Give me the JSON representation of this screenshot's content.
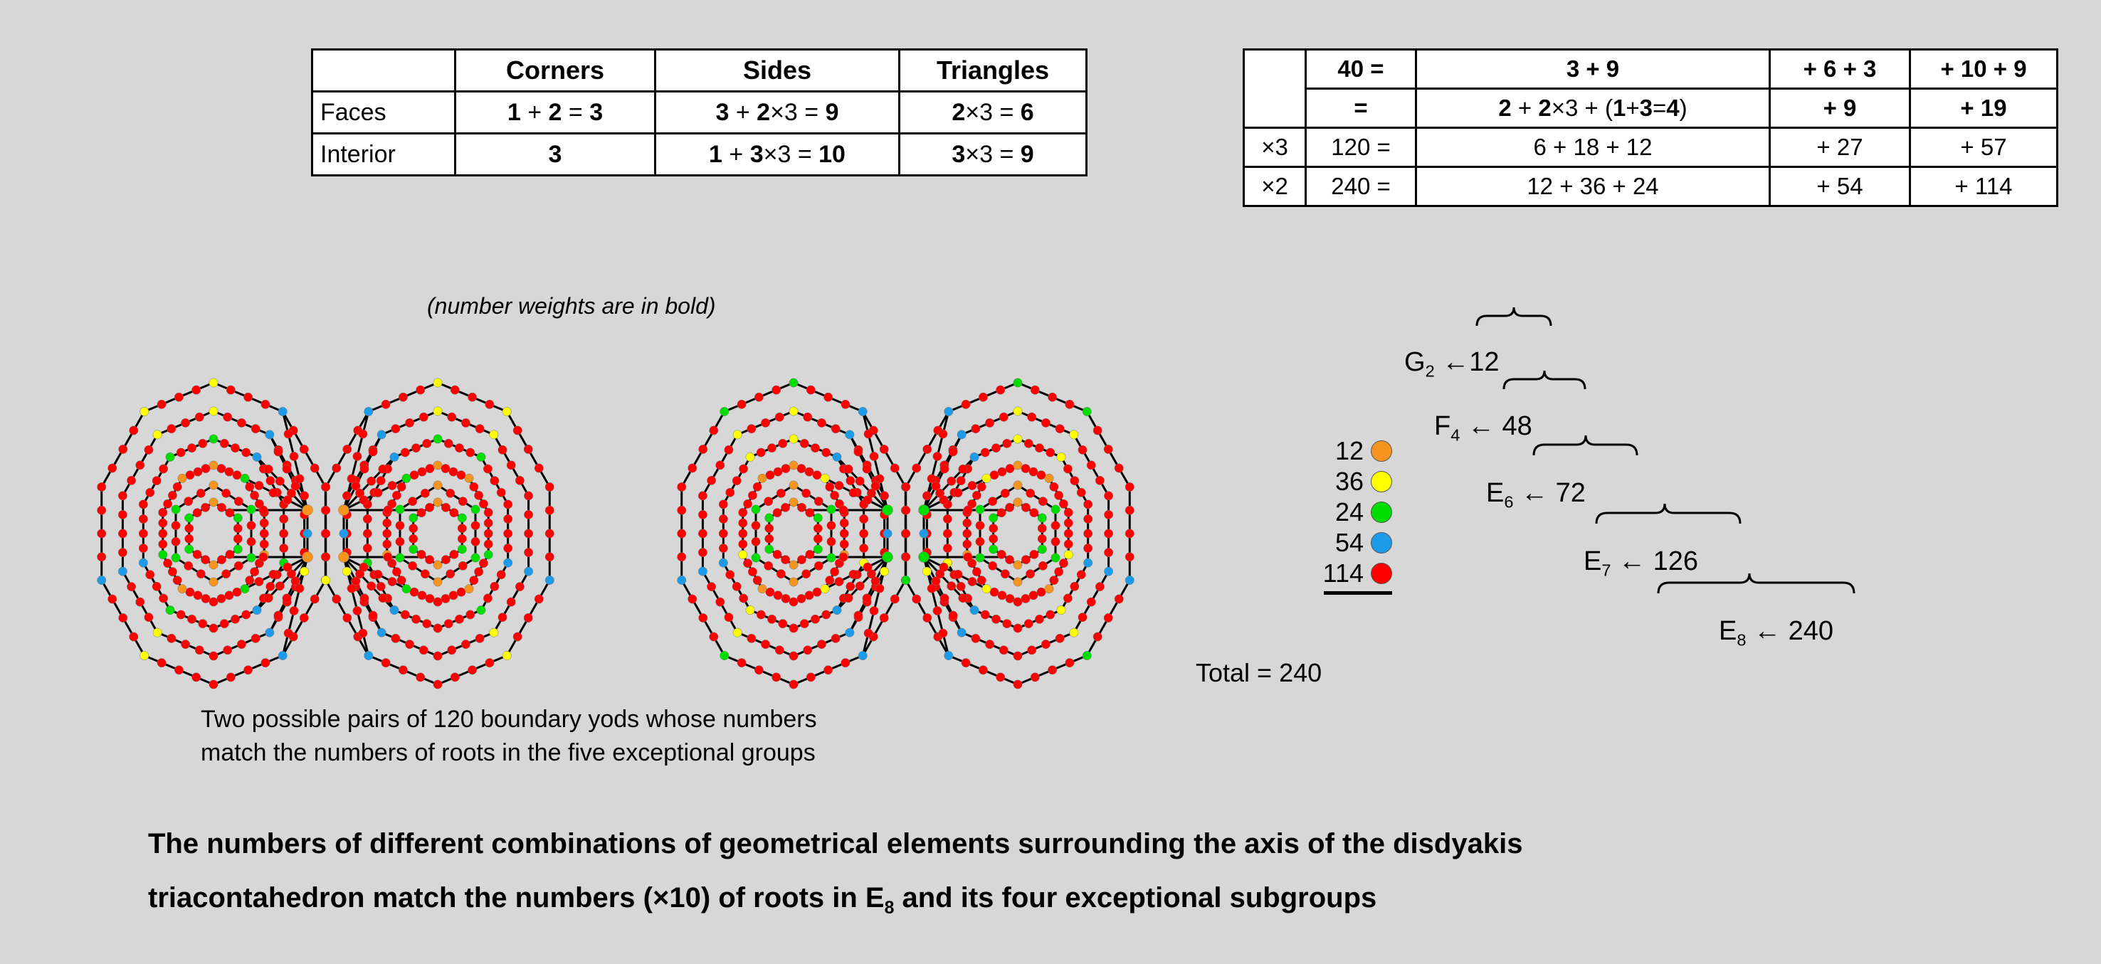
{
  "background": "#d7d7d7",
  "left_table": {
    "name": "geometrical-elements-table",
    "headers": [
      "",
      "Corners",
      "Sides",
      "Triangles"
    ],
    "rows": [
      {
        "label": "Faces",
        "corners_html": "<b>1</b> + <b>2</b> = <b>3</b>",
        "corners_text": "1 + 2 = 3",
        "sides_html": "<b>3</b> + <b>2</b>×3  = <b>9</b>",
        "sides_text": "3 + 2×3  = 9",
        "triangles_html": "<b>2</b>×3 = <b>6</b>",
        "triangles_text": "2×3 = 6"
      },
      {
        "label": "Interior",
        "corners_html": "<b>3</b>",
        "corners_text": "3",
        "sides_html": "<b>1</b> + <b>3</b>×3 = <b>10</b>",
        "sides_text": "1 + 3×3 = 10",
        "triangles_html": "<b>3</b>×3 = <b>9</b>",
        "triangles_text": "3×3 = 9"
      }
    ]
  },
  "note_weights": "(number weights are in bold)",
  "right_table": {
    "name": "root-decomposition-table",
    "rows": [
      {
        "multiplier": "",
        "total_html": "<b>40 =</b>",
        "total_text": "40 =",
        "col3_html": "<b>3 + 9</b>",
        "col3_text": "3 + 9",
        "col4_html": "<b>+ 6 + 3</b>",
        "col4_text": "+ 6 + 3",
        "col5_html": "<b>+ 10 + 9</b>",
        "col5_text": "+ 10 + 9"
      },
      {
        "multiplier": "",
        "total_html": "<b>=</b>",
        "total_text": "=",
        "col3_html": "<b>2</b> + <b>2</b>×3 + (<b>1</b>+<b>3</b>=<b>4</b>)",
        "col3_text": "2 + 2×3 + (1+3=4)",
        "col4_html": "<b>+ 9</b>",
        "col4_text": "+ 9",
        "col5_html": "<b>+ 19</b>",
        "col5_text": "+ 19"
      },
      {
        "multiplier": "×3",
        "total_html": "120 =",
        "total_text": "120 =",
        "col3_html": "6 + 18 + 12",
        "col3_text": "6 + 18 + 12",
        "col4_html": "+ 27",
        "col4_text": "+ 27",
        "col5_html": "+ 57",
        "col5_text": "+ 57"
      },
      {
        "multiplier": "×2",
        "total_html": "240 =",
        "total_text": "240 =",
        "col3_html": "12 + 36 + 24",
        "col3_text": "12 + 36 + 24",
        "col4_html": "+ 54",
        "col4_text": "+ 54",
        "col5_html": "+ 114",
        "col5_text": "+ 114"
      }
    ]
  },
  "legend": {
    "name": "yod-count-legend",
    "items": [
      {
        "count": "12",
        "color": "#f5941f"
      },
      {
        "count": "36",
        "color": "#ffff00"
      },
      {
        "count": "24",
        "color": "#00dd00"
      },
      {
        "count": "54",
        "color": "#1e9be8"
      },
      {
        "count": "114",
        "color": "#ff0000"
      }
    ],
    "total_label": "Total = 240",
    "total_value": "240"
  },
  "groups": [
    {
      "label": "G",
      "sub": "2",
      "arrow": "←",
      "value": "12"
    },
    {
      "label": "F",
      "sub": "4",
      "arrow": "←",
      "value": "48"
    },
    {
      "label": "E",
      "sub": "6",
      "arrow": "←",
      "value": "72"
    },
    {
      "label": "E",
      "sub": "7",
      "arrow": "←",
      "value": "126"
    },
    {
      "label": "E",
      "sub": "8",
      "arrow": "←",
      "value": "240"
    }
  ],
  "caption_yods": {
    "line1": "Two possible pairs of 120 boundary yods whose numbers",
    "line2": "match the numbers of roots in the five exceptional groups"
  },
  "caption_main": {
    "line1": "The numbers of different combinations of geometrical elements surrounding the axis of the disdyakis",
    "line2_pre": "triacontahedron match the numbers (×10) of roots in E",
    "line2_sub": "8",
    "line2_post": " and its four exceptional subgroups"
  },
  "diagram": {
    "name": "disdyakis-triacontahedron-projections",
    "count": 4,
    "ring_count": 4,
    "colors": {
      "orange": "#f5941f",
      "yellow": "#ffff00",
      "green": "#00dd00",
      "blue": "#1e9be8",
      "red": "#ff0000",
      "edge": "#000000"
    },
    "hub_colors": [
      "#f5941f",
      "#f5941f",
      "#00dd00",
      "#00dd00"
    ]
  }
}
